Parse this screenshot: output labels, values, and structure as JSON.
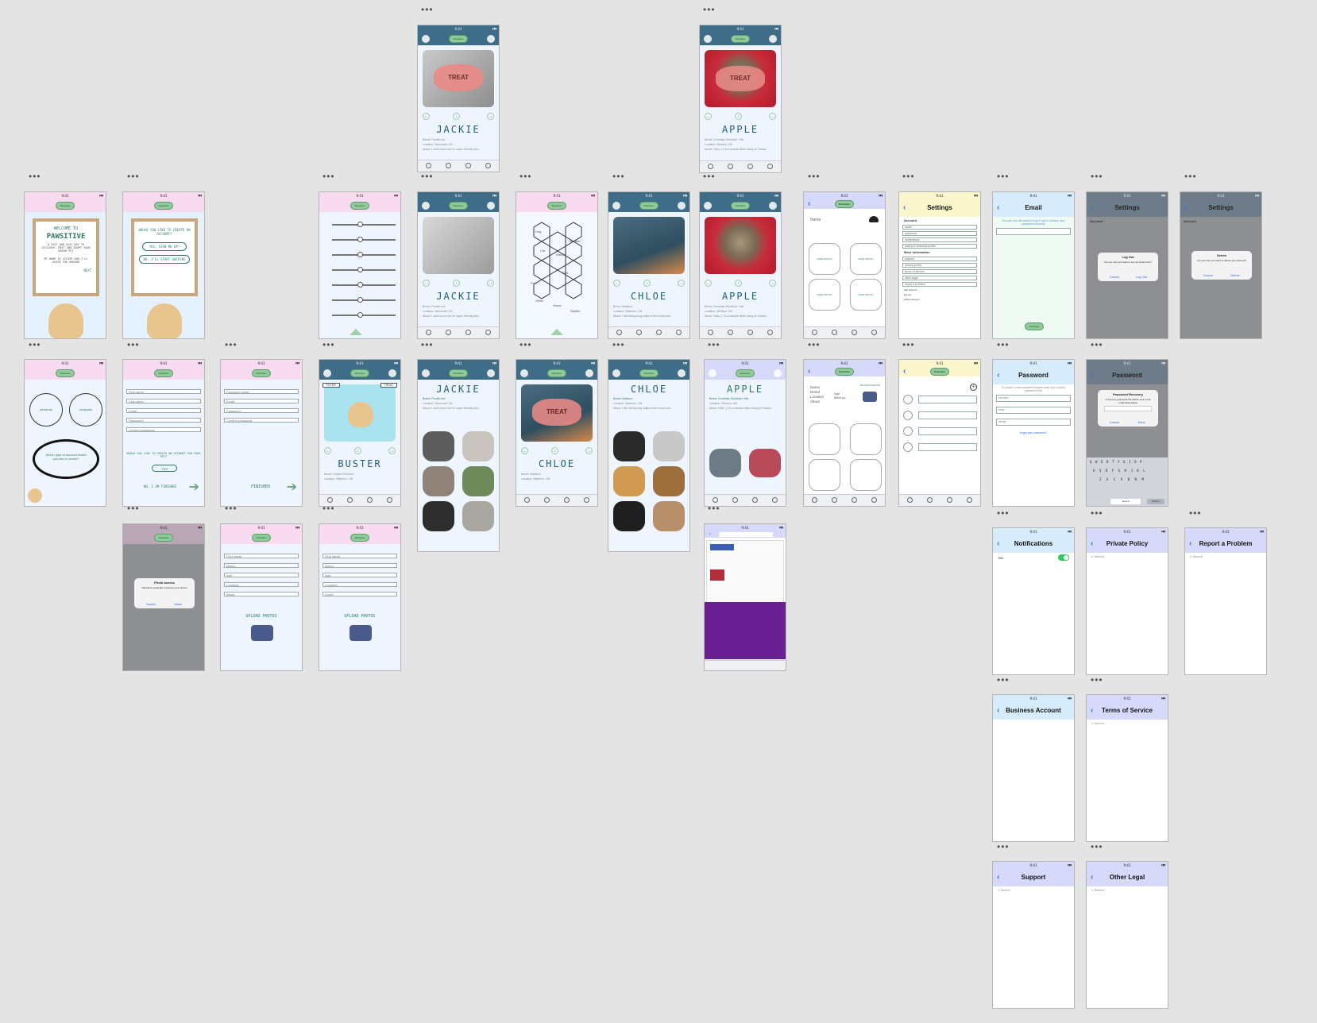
{
  "app": {
    "logo": "Pawsitive",
    "status_time": "9:41"
  },
  "colors": {
    "background": "#e4e4e4",
    "accent_green": "#8fca9a",
    "teal_header": "#3f6c86",
    "pink_header": "#f8dbf0",
    "link_blue": "#2f6de0"
  },
  "welcome": {
    "title_line1": "WELCOME TO",
    "title_line2": "PAWSITIVE",
    "tagline": "A FAST AND EASY WAY TO DISCOVER, MEET AND ADOPT YOUR DREAM PET",
    "intro": "MY NAME IS LESTER AND I'LL GUIDE YOU AROUND",
    "next": "NEXT"
  },
  "account_prompt": {
    "question": "WOULD YOU LIKE TO CREATE AN ACCOUNT?",
    "yes": "YES, SIGN ME UP!",
    "no": "NO, I'LL START SWIPING"
  },
  "account_type": {
    "personal": "personal",
    "company": "company",
    "question": "Which type of account would you like to create?"
  },
  "personal_form": {
    "fields": [
      "First name:",
      "Last name:",
      "Email:",
      "Password:",
      "Confirm password:"
    ],
    "pet_question": "WOULD YOU LIKE TO CREATE AN ACCOUNT FOR YOUR PET?",
    "yes": "YES",
    "finished": "NO, I AM FINISHED"
  },
  "company_form": {
    "fields": [
      "Company name:",
      "Email:",
      "Password:",
      "Confirm password:"
    ],
    "finished": "FINISHED"
  },
  "photo_access": {
    "title": "Photo access",
    "body": "Pawsitive would like to access your photos",
    "cancel": "Cancel",
    "allow": "Allow"
  },
  "pet_form_1": {
    "fields": [
      "First name:",
      "Breed:",
      "Age:",
      "Location:",
      "About:"
    ],
    "upload": "UPLOAD PHOTOS"
  },
  "pet_form_2": {
    "fields": [
      "First name:",
      "Breed:",
      "Age:",
      "Location:",
      "About:"
    ],
    "upload": "UPLOAD PHOTOS"
  },
  "filters": {
    "screen": "sliders"
  },
  "categories": {
    "items": [
      "Dog",
      "Cat",
      "Hamster",
      "Rabbit",
      "Bird",
      "Fish",
      "Other",
      "Horse",
      "Reptile"
    ]
  },
  "pets": {
    "jackie": {
      "name": "JACKIE",
      "breed": "Breed: Poodle mix",
      "location": "Location: Vancouver, BC",
      "age": "Age: 7",
      "about": "About: I can't move but I'm super friendly and..."
    },
    "chloe": {
      "name": "CHLOE",
      "breed": "Breed: Maltipoo",
      "location": "Location: Waterloo, ON",
      "age": "Age: 6",
      "about": "About: I like taking long walks in the forest and..."
    },
    "apple": {
      "name": "APPLE",
      "breed": "Breed: Domestic Shorthair / Mix",
      "location": "Location: Windsor, ON",
      "age": "Age: 3 months",
      "about": "About: Hello :) I'm a miracle kitten living at Ontario..."
    },
    "buster": {
      "name": "BUSTER",
      "breed": "Breed: Golden Retriever",
      "location": "Location: Waterloo, ON",
      "filter": "FILTER",
      "treat": "TREAT"
    }
  },
  "treat_label": "TREAT",
  "profile": {
    "name": "Name",
    "breed": "Breed",
    "location": "Location",
    "about": "About",
    "age": "Age",
    "meet": "Meet up",
    "save_photo": "SAVE PHOTO",
    "upload": "UPLOAD PHOTOS"
  },
  "settings": {
    "title": "Settings",
    "account_heading": "Account",
    "account_items": [
      "email",
      "password",
      "notifications",
      "switch to business profile"
    ],
    "more_heading": "More information",
    "more_items": [
      "support",
      "privacy policy",
      "terms of service",
      "other legal",
      "report a problem"
    ],
    "extra": [
      "add account",
      "log out",
      "delete account"
    ]
  },
  "email_screen": {
    "title": "Email",
    "hint": "You can use this email to log in, get in contact, and password recovery"
  },
  "password_screen": {
    "title": "Password",
    "hint": "To create a new password please enter your current password first",
    "fields": [
      "current",
      "new",
      "verify"
    ],
    "forgot": "forgot your password?"
  },
  "logout_dialog": {
    "title": "Log Out",
    "body": "Are you sure you want to log out at this time?",
    "cancel": "Cancel",
    "confirm": "Log Out"
  },
  "delete_dialog": {
    "title": "Delete",
    "body": "Are you sure you want to delete your account?",
    "cancel": "Cancel",
    "confirm": "Delete"
  },
  "recovery_dialog": {
    "title": "Password Recovery",
    "body": "A recovery password link will be sent to the email listed below",
    "cancel": "Cancel",
    "send": "Send"
  },
  "keyboard": {
    "row1": "QWERTYUIOP",
    "row2": "ASDFGHJKL",
    "row3": "ZXCVBNM",
    "space": "space",
    "return": "return"
  },
  "notifications": {
    "title": "Notifications",
    "row": "Title"
  },
  "private_policy": {
    "title": "Private Policy",
    "search": "Search"
  },
  "report": {
    "title": "Report a Problem",
    "search": "Search"
  },
  "business": {
    "title": "Business Account"
  },
  "terms": {
    "title": "Terms of Service",
    "search": "Search"
  },
  "support": {
    "title": "Support",
    "search": "Search"
  },
  "other_legal": {
    "title": "Other Legal",
    "search": "Search"
  },
  "dots": "•••"
}
